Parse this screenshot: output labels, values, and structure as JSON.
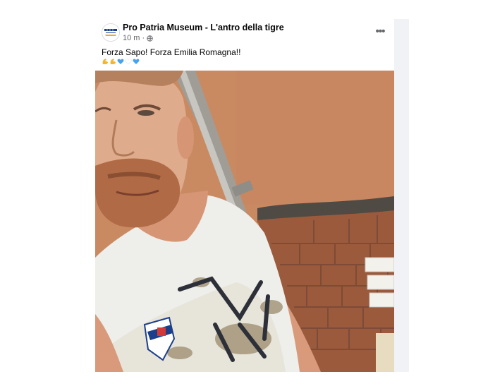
{
  "post": {
    "page_name": "Pro Patria Museum - L'antro della tigre",
    "time_ago": "10 m",
    "separator": "·",
    "audience_icon": "globe-icon",
    "more_icon": "more-options-icon",
    "more_label": "•••",
    "text": "Forza Sapo! Forza Emilia Romagna!!",
    "emojis": [
      "flexed-biceps",
      "flexed-biceps",
      "blue-heart",
      "white-heart",
      "blue-heart"
    ],
    "photo_icon": "selfie-photo"
  },
  "colors": {
    "name": "#050505",
    "meta": "#65676b",
    "background": "#ffffff",
    "side_strip": "#f0f2f5",
    "wall": "#c98a62",
    "brick": "#9b5a3c",
    "shirt": "#eeeeea"
  }
}
